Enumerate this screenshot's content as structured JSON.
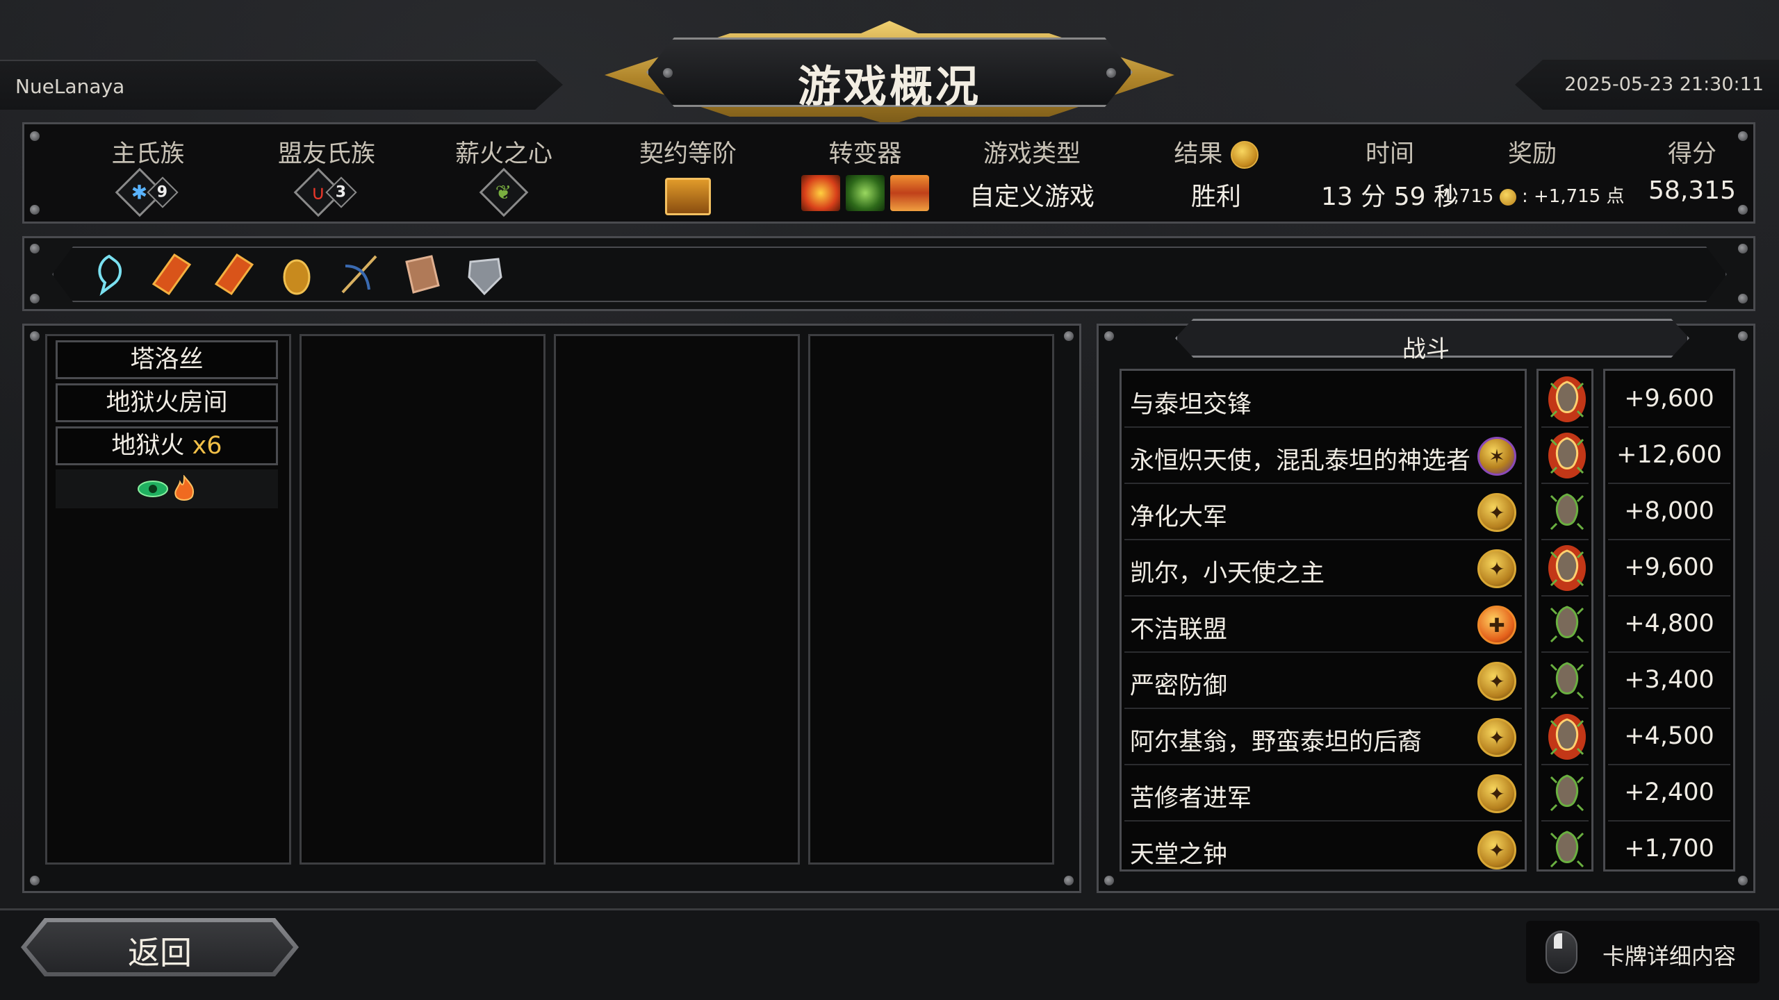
{
  "header": {
    "player_name": "NueLanaya",
    "title": "游戏概况",
    "datetime": "2025-05-23 21:30:11"
  },
  "stats": {
    "main_clan_label": "主氏族",
    "main_clan_level": "9",
    "ally_clan_label": "盟友氏族",
    "ally_clan_level": "3",
    "pyre_label": "薪火之心",
    "covenant_label": "契约等阶",
    "mutators_label": "转变器",
    "game_type_label": "游戏类型",
    "game_type_value": "自定义游戏",
    "result_label": "结果",
    "result_value": "胜利",
    "time_label": "时间",
    "time_value": "13 分 59 秒",
    "reward_label": "奖励",
    "reward_value": "1,715",
    "reward_points": ": +1,715 点",
    "score_label": "得分",
    "score_value": "58,315"
  },
  "relics": [
    "storm-rune-icon",
    "ember-shard-icon",
    "ember-shard-icon",
    "golden-idol-icon",
    "bow-icon",
    "spellbook-icon",
    "stone-shard-icon"
  ],
  "deck": {
    "cards": [
      {
        "label": "塔洛丝"
      },
      {
        "label": "地狱火房间"
      },
      {
        "label": "地狱火",
        "multiplier": "x6"
      }
    ]
  },
  "battle": {
    "title": "战斗",
    "rows": [
      {
        "name": "与泰坦交锋",
        "coin": "none",
        "heart": "red",
        "score": "+9,600"
      },
      {
        "name": "永恒炽天使，混乱泰坦的神选者",
        "coin": "purple",
        "heart": "red",
        "score": "+12,600"
      },
      {
        "name": "净化大军",
        "coin": "gold",
        "heart": "green",
        "score": "+8,000"
      },
      {
        "name": "凯尔，小天使之主",
        "coin": "gold",
        "heart": "red",
        "score": "+9,600"
      },
      {
        "name": "不洁联盟",
        "coin": "orange",
        "heart": "green",
        "score": "+4,800"
      },
      {
        "name": "严密防御",
        "coin": "gold",
        "heart": "green",
        "score": "+3,400"
      },
      {
        "name": "阿尔基翁，野蛮泰坦的后裔",
        "coin": "gold",
        "heart": "red",
        "score": "+4,500"
      },
      {
        "name": "苦修者进军",
        "coin": "gold",
        "heart": "green",
        "score": "+2,400"
      },
      {
        "name": "天堂之钟",
        "coin": "gold",
        "heart": "green",
        "score": "+1,700"
      }
    ]
  },
  "footer": {
    "back_label": "返回",
    "details_label": "卡牌详细内容"
  }
}
